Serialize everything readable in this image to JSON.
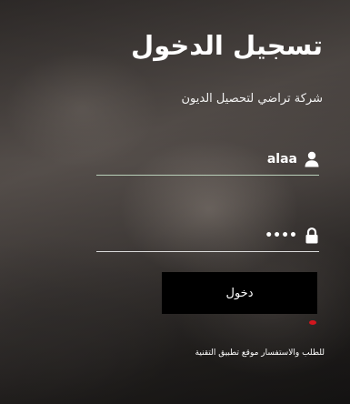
{
  "login": {
    "title": "تسجيل الدخول",
    "subtitle": "شركة تراضي لتحصيل الديون",
    "username_value": "alaa",
    "password_value": "1234",
    "submit_label": "دخول",
    "footer_link": "للطلب والاستفسار موقع تطبيق التقنية",
    "accent_color": "#d2161e"
  },
  "icons": {
    "username": "user-icon",
    "password": "lock-icon"
  }
}
